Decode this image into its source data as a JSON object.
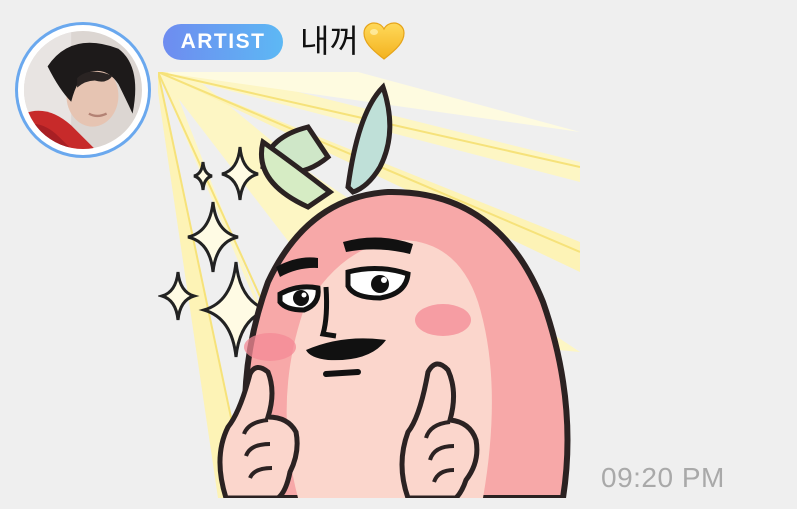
{
  "message": {
    "badge_label": "ARTIST",
    "sender_name": "내꺼",
    "reaction_icon": "yellow-heart-icon",
    "timestamp": "09:20 PM",
    "sticker": "peach-character-thumbs-up-sticker"
  },
  "colors": {
    "avatar_ring": "#6aa8ee",
    "badge_gradient_start": "#6e8cf0",
    "badge_gradient_end": "#5db8f4",
    "heart": "#f9c53b",
    "timestamp": "#a9a9a9",
    "background": "#efefef"
  }
}
